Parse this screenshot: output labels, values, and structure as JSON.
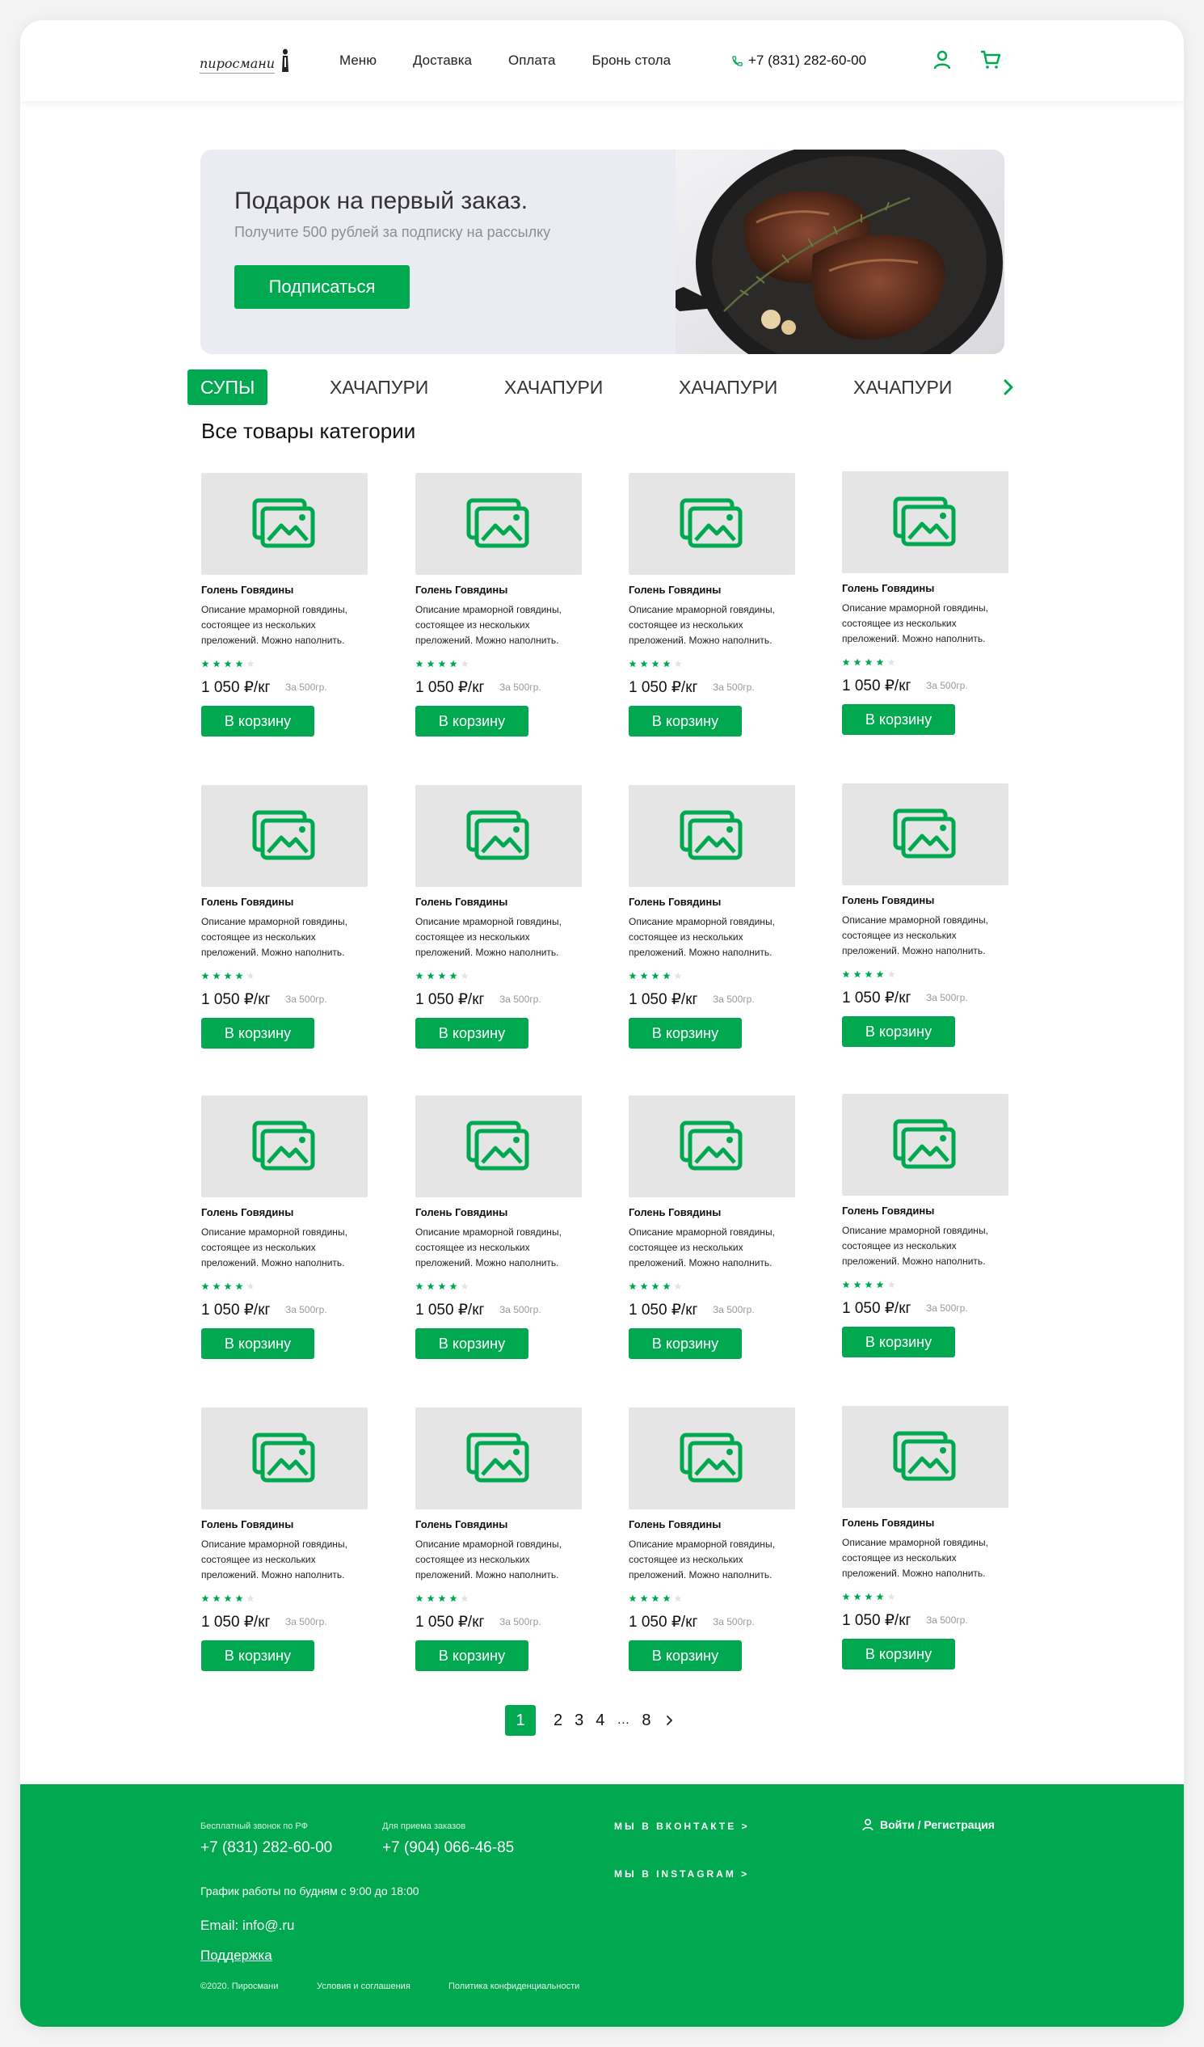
{
  "header": {
    "logo_text": "пиросмани",
    "nav": [
      "Меню",
      "Доставка",
      "Оплата",
      "Бронь стола"
    ],
    "phone": "+7 (831) 282-60-00"
  },
  "banner": {
    "title": "Подарок на первый заказ.",
    "subtitle": "Получите 500 рублей за подписку на рассылку",
    "button": "Подписаться"
  },
  "tabs": [
    "СУПЫ",
    "ХАЧАПУРИ",
    "ХАЧАПУРИ",
    "ХАЧАПУРИ",
    "ХАЧАПУРИ"
  ],
  "active_tab": 0,
  "section_title": "Все товары категории",
  "product": {
    "name": "Голень Говядины",
    "desc_lines": [
      "Описание мраморной говядины,",
      "состоящее из нескольких",
      "преложений. Можно наполнить."
    ],
    "rating": 4,
    "rating_max": 5,
    "price": "1 050 ₽/кг",
    "weight": "За 500гр.",
    "button": "В корзину"
  },
  "grid": {
    "rows": 4,
    "cols": 4
  },
  "pagination": {
    "pages": [
      "1",
      "2",
      "3",
      "4",
      "…",
      "8"
    ],
    "current": "1"
  },
  "footer": {
    "free_call_caption": "Бесплатный звонок по РФ",
    "free_call_phone": "+7 (831) 282-60-00",
    "orders_caption": "Для приема заказов",
    "orders_phone": "+7 (904) 066-46-85",
    "schedule": "График работы по будням с 9:00 до 18:00",
    "email": "Email: info@.ru",
    "support": "Поддержка",
    "vk": "МЫ В ВКОНТАКТЕ >",
    "instagram": "МЫ В INSTAGRAM >",
    "login": "Войти / Регистрация",
    "copyright": "©2020. Пиросмани",
    "terms": "Условия и соглашения",
    "privacy": "Политика конфиденциальности"
  },
  "colors": {
    "accent": "#00a94f",
    "placeholder_bg": "#e5e5e5",
    "banner_bg": "#ebebf3"
  },
  "icons": [
    "phone-icon",
    "user-icon",
    "cart-icon",
    "image-placeholder-icon",
    "star-icon",
    "chevron-right-icon"
  ]
}
